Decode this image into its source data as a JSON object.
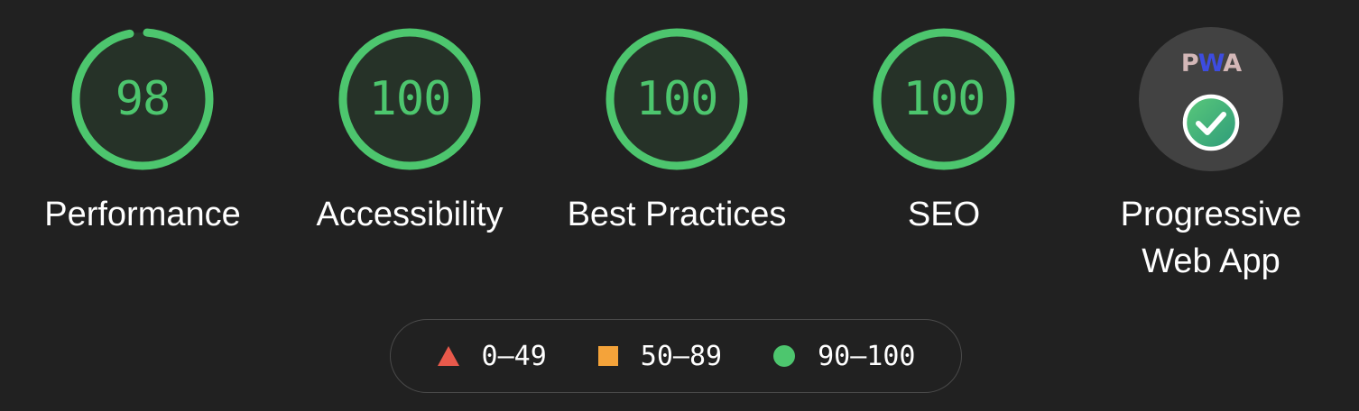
{
  "categories": [
    {
      "id": "performance",
      "label": "Performance",
      "score": "98",
      "fraction": 0.98
    },
    {
      "id": "accessibility",
      "label": "Accessibility",
      "score": "100",
      "fraction": 1.0
    },
    {
      "id": "best-practices",
      "label": "Best Practices",
      "score": "100",
      "fraction": 1.0
    },
    {
      "id": "seo",
      "label": "SEO",
      "score": "100",
      "fraction": 1.0
    }
  ],
  "pwa": {
    "label_line1": "Progressive",
    "label_line2": "Web App",
    "logo_p": "P",
    "logo_w": "W",
    "logo_a": "A",
    "status": "passed"
  },
  "legend": [
    {
      "range": "0–49",
      "shape": "triangle",
      "color": "#e8594b"
    },
    {
      "range": "50–89",
      "shape": "square",
      "color": "#f4a33a"
    },
    {
      "range": "90–100",
      "shape": "circle",
      "color": "#4dc66e"
    }
  ],
  "colors": {
    "pass": "#4dc66e",
    "pass_bg": "#263228",
    "background": "#212121"
  }
}
